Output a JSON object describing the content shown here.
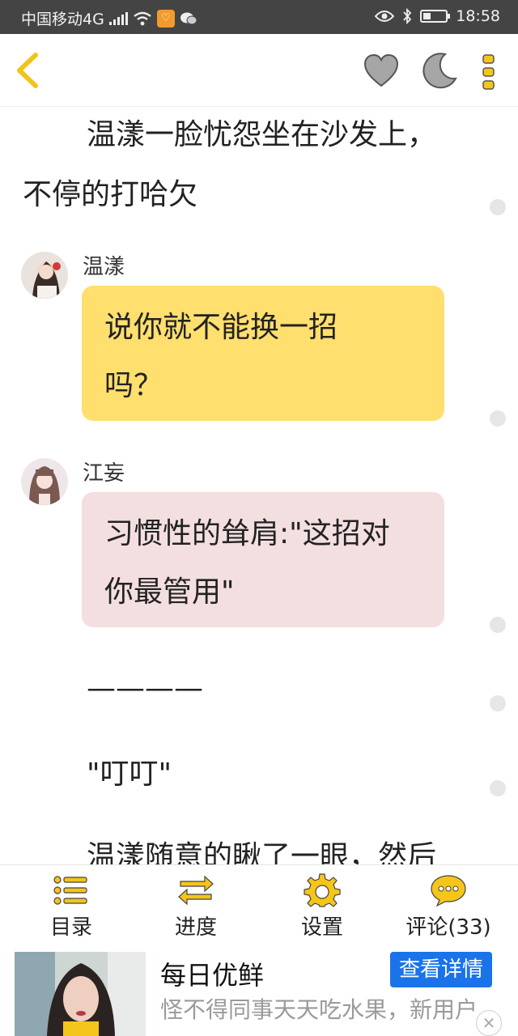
{
  "status_bar": {
    "carrier": "中国移动4G",
    "network_tag": "4G",
    "time": "18:58"
  },
  "app_bar": {
    "icons": [
      "back-icon",
      "heart-icon",
      "moon-icon",
      "more-icon"
    ]
  },
  "story": {
    "para1_line1": "温漾一脸忧怨坐在沙发上，",
    "para1_line2": "不停的打哈欠",
    "msg1": {
      "speaker": "温漾",
      "line1": "说你就不能换一招",
      "line2": "吗？"
    },
    "msg2": {
      "speaker": "江妄",
      "line1": "习惯性的耸肩:\"这招对",
      "line2": "你最管用\""
    },
    "separator": "————",
    "sound": "\"叮叮\"",
    "partial_line": "温漾随意的瞅了一眼，然后"
  },
  "toolbar": {
    "catalog_label": "目录",
    "progress_label": "进度",
    "settings_label": "设置",
    "comments_label": "评论(33)"
  },
  "ad": {
    "title": "每日优鲜",
    "button_label": "查看详情",
    "description": "怪不得同事天天吃水果，新用户"
  },
  "colors": {
    "accent": "#f5c518",
    "bubble_yellow": "#ffdf6e",
    "bubble_pink": "#f3dfe0",
    "ad_button": "#1a73e8",
    "status_bar": "#444444"
  }
}
